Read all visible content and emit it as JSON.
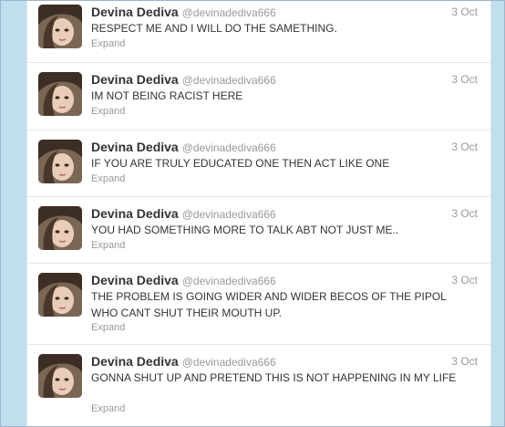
{
  "tweets": [
    {
      "name": "Devina Dediva",
      "handle": "@devinadediva666",
      "time": "3 Oct",
      "text": "RESPECT ME AND I WILL DO THE SAMETHING.",
      "expand": "Expand"
    },
    {
      "name": "Devina Dediva",
      "handle": "@devinadediva666",
      "time": "3 Oct",
      "text": "IM NOT BEING RACIST HERE",
      "expand": "Expand"
    },
    {
      "name": "Devina Dediva",
      "handle": "@devinadediva666",
      "time": "3 Oct",
      "text": "IF YOU ARE TRULY EDUCATED ONE THEN ACT LIKE ONE",
      "expand": "Expand"
    },
    {
      "name": "Devina Dediva",
      "handle": "@devinadediva666",
      "time": "3 Oct",
      "text": "YOU HAD SOMETHING MORE TO TALK ABT NOT JUST ME..",
      "expand": "Expand"
    },
    {
      "name": "Devina Dediva",
      "handle": "@devinadediva666",
      "time": "3 Oct",
      "text": "THE PROBLEM IS GOING WIDER AND WIDER BECOS OF THE PIPOL WHO CANT SHUT THEIR MOUTH UP.",
      "expand": "Expand"
    },
    {
      "name": "Devina Dediva",
      "handle": "@devinadediva666",
      "time": "3 Oct",
      "text": "GONNA SHUT UP AND PRETEND THIS IS NOT HAPPENING IN MY LIFE",
      "expand": "Expand"
    }
  ]
}
